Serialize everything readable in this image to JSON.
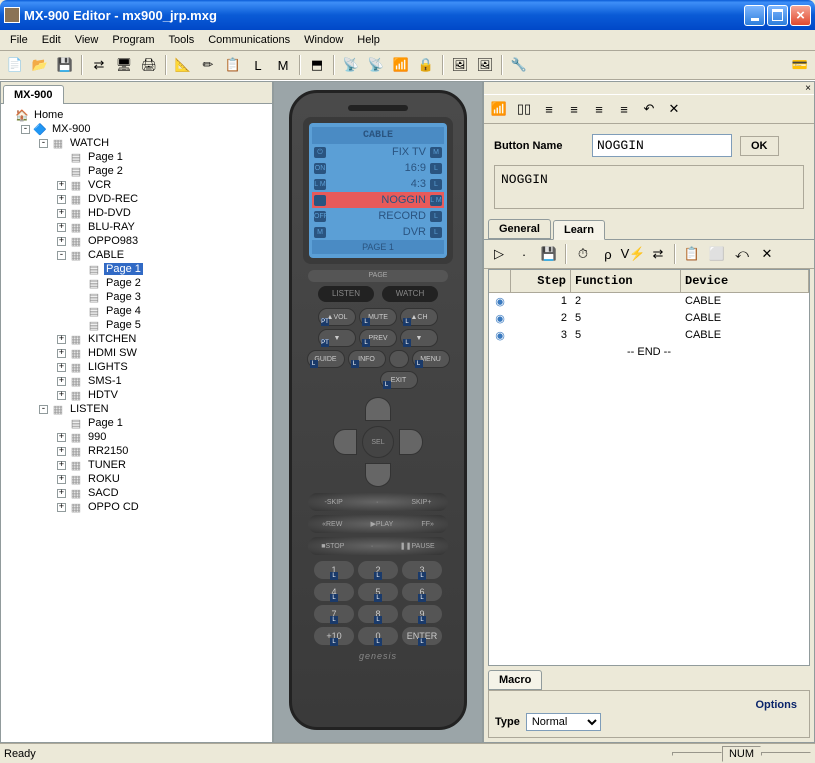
{
  "title": "MX-900 Editor - mx900_jrp.mxg",
  "menus": [
    "File",
    "Edit",
    "View",
    "Program",
    "Tools",
    "Communications",
    "Window",
    "Help"
  ],
  "toolbar_icons": [
    "📄",
    "📂",
    "💾",
    "|",
    "⇄",
    "🖥",
    "🖨",
    "|",
    "📐",
    "✏",
    "📋",
    "L",
    "M",
    "|",
    "⬒",
    "|",
    "📡",
    "📡",
    "📶",
    "🔒",
    "|",
    "🖼",
    "🖼",
    "|",
    "🔧"
  ],
  "tree_tab": "MX-900",
  "tree": {
    "root": {
      "label": "Home",
      "icon": "🏠"
    },
    "device": "MX-900",
    "watch": "WATCH",
    "watch_pages": [
      "Page 1",
      "Page 2"
    ],
    "watch_devices": [
      "VCR",
      "DVD-REC",
      "HD-DVD",
      "BLU-RAY",
      "OPPO983"
    ],
    "cable": "CABLE",
    "cable_pages": [
      "Page 1",
      "Page 2",
      "Page 3",
      "Page 4",
      "Page 5"
    ],
    "cable_selected_index": 0,
    "watch_devices2": [
      "KITCHEN",
      "HDMI SW",
      "LIGHTS",
      "SMS-1",
      "HDTV"
    ],
    "listen": "LISTEN",
    "listen_pages": [
      "Page 1"
    ],
    "listen_devices": [
      "990",
      "RR2150",
      "TUNER",
      "ROKU",
      "SACD",
      "OPPO CD"
    ]
  },
  "lcd": {
    "header": "CABLE",
    "rows": [
      {
        "text": "FIX TV",
        "left": "⏻",
        "right": "M",
        "hl": false
      },
      {
        "text": "16:9",
        "left": "ON",
        "right": "L",
        "hl": false
      },
      {
        "text": "4:3",
        "left": "L M",
        "right": "L",
        "hl": false
      },
      {
        "text": "NOGGIN",
        "left": "",
        "right": "L M",
        "hl": true
      },
      {
        "text": "RECORD",
        "left": "OFF",
        "right": "L",
        "hl": false
      },
      {
        "text": "DVR",
        "left": "M",
        "right": "L",
        "hl": false
      }
    ],
    "footer": "PAGE 1",
    "page_label": "PAGE",
    "modes": [
      "LISTEN",
      "WATCH"
    ]
  },
  "numpad": [
    "1",
    "2",
    "3",
    "4",
    "5",
    "6",
    "7",
    "8",
    "9",
    "+10",
    "0",
    "ENTER"
  ],
  "transport1": [
    "-SKIP",
    "·",
    "SKIP+"
  ],
  "transport2": [
    "«REW",
    "▶PLAY",
    "FF»"
  ],
  "transport3": [
    "■STOP",
    "·",
    "❚❚PAUSE"
  ],
  "remote_brand": "genesis",
  "right_toolbar": [
    "📶",
    "▯▯",
    "≡",
    "≡",
    "≡",
    "≡",
    "↶",
    "✕"
  ],
  "button_name_label": "Button Name",
  "button_name_value": "NOGGIN",
  "ok_label": "OK",
  "name_display": "NOGGIN",
  "prop_tabs": [
    "General",
    "Learn"
  ],
  "macro_toolbar": [
    "▷",
    "·",
    "💾",
    "|",
    "⏱",
    "ρ",
    "V⚡",
    "⇄",
    "|",
    "📋",
    "⬜",
    "⤺",
    "✕"
  ],
  "grid": {
    "headers": [
      "",
      "Step",
      "Function",
      "Device"
    ],
    "rows": [
      {
        "step": "1",
        "func": "2",
        "device": "CABLE"
      },
      {
        "step": "2",
        "func": "5",
        "device": "CABLE"
      },
      {
        "step": "3",
        "func": "5",
        "device": "CABLE"
      }
    ],
    "end": "-- END --"
  },
  "macro_tab": "Macro",
  "options_label": "Options",
  "type_label": "Type",
  "type_value": "Normal",
  "status": {
    "ready": "Ready",
    "num": "NUM"
  }
}
